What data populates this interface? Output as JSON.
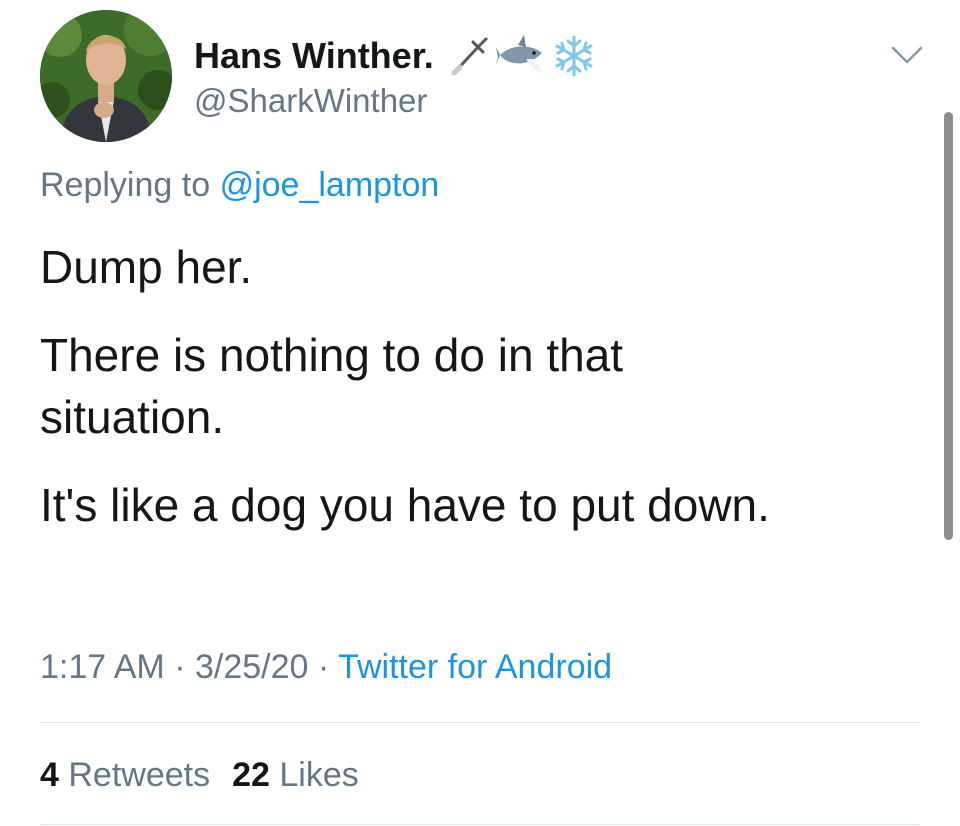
{
  "tweet": {
    "author": {
      "display_name": "Hans Winther.",
      "name_emojis": [
        "dagger-icon",
        "shark-icon",
        "snowflake-icon"
      ],
      "handle": "@SharkWinther"
    },
    "replying_prefix": "Replying to",
    "replying_to": "@joe_lampton",
    "text_paragraphs": [
      "Dump her.",
      "There is nothing to do in that situation.",
      "It's like a dog you have to put down."
    ],
    "time": "1:17 AM",
    "date": "3/25/20",
    "source": "Twitter for Android",
    "separator": "·",
    "retweets_count": "4",
    "retweets_label": "Retweets",
    "likes_count": "22",
    "likes_label": "Likes"
  },
  "colors": {
    "text": "#14171a",
    "secondary": "#657786",
    "link": "#1b95e0",
    "divider": "#e1e8ed"
  }
}
